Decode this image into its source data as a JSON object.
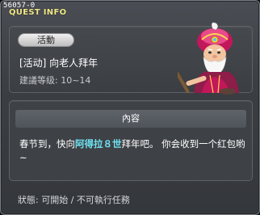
{
  "header": {
    "quest_id": "56057-0",
    "title": "QUEST INFO"
  },
  "quest": {
    "category_badge": "活動",
    "name": "[活动] 向老人拜年",
    "level": "建議等级: 10~14"
  },
  "content": {
    "section_title": "內容",
    "desc_before": "春节到，快向",
    "desc_highlight": "阿得拉８世",
    "desc_after": "拜年吧。 你会收到一个红包哟~"
  },
  "footer": {
    "status": "狀態:  可開始 / 不可執行任務"
  },
  "colors": {
    "title": "#f2e98a",
    "highlight": "#6fe3f0",
    "panel": "#3e4146"
  },
  "icons": {
    "npc": "old-man-with-turban-npc-icon"
  }
}
